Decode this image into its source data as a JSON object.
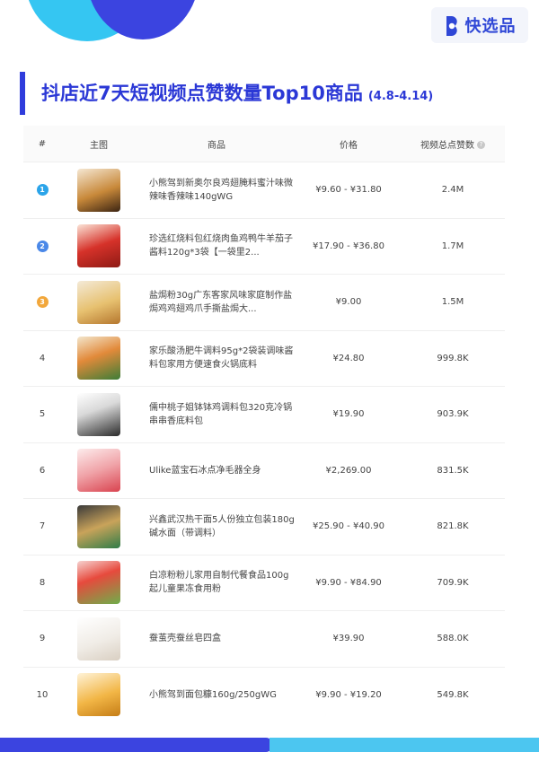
{
  "brand": {
    "name": "快选品",
    "logo_icon": "brand-b-icon"
  },
  "title": {
    "main": "抖店近7天短视频点赞数量Top10商品",
    "range": "(4.8-4.14)"
  },
  "colors": {
    "accent": "#2b38d6",
    "rank1": "#2ba4e9",
    "rank2": "#4a88e8",
    "rank3": "#f2a73b"
  },
  "table": {
    "headers": {
      "index": "#",
      "image": "主图",
      "name": "商品",
      "price": "价格",
      "likes": "视频总点赞数"
    },
    "help_icon": "question-circle-icon",
    "rows": [
      {
        "rank": "1",
        "name": "小熊驾到新奥尔良鸡翅腌料蜜汁味微辣味香辣味140gWG",
        "price": "¥9.60 - ¥31.80",
        "likes": "2.4M",
        "image_icon": "seasoning-jar-thumbnail"
      },
      {
        "rank": "2",
        "name": "珍选红烧料包红烧肉鱼鸡鸭牛羊茄子酱料120g*3袋【一袋里2...",
        "price": "¥17.90 - ¥36.80",
        "likes": "1.7M",
        "image_icon": "braise-sauce-thumbnail"
      },
      {
        "rank": "3",
        "name": "盐焗粉30g广东客家风味家庭制作盐焗鸡鸡翅鸡爪手撕盐焗大...",
        "price": "¥9.00",
        "likes": "1.5M",
        "image_icon": "salt-baked-powder-thumbnail"
      },
      {
        "rank": "4",
        "name": "家乐酸汤肥牛调料95g*2袋装调味酱料包家用方便速食火锅底料",
        "price": "¥24.80",
        "likes": "999.8K",
        "image_icon": "sour-soup-sauce-thumbnail"
      },
      {
        "rank": "5",
        "name": "儒中桃子姐钵钵鸡调料包320克冷锅串串香底料包",
        "price": "¥19.90",
        "likes": "903.9K",
        "image_icon": "bobo-chicken-sauce-thumbnail"
      },
      {
        "rank": "6",
        "name": "Ulike蓝宝石冰点净毛器全身",
        "price": "¥2,269.00",
        "likes": "831.5K",
        "image_icon": "hair-removal-device-thumbnail"
      },
      {
        "rank": "7",
        "name": "兴鑫武汉热干面5人份独立包装180g碱水面（带调料）",
        "price": "¥25.90 - ¥40.90",
        "likes": "821.8K",
        "image_icon": "hot-dry-noodles-thumbnail"
      },
      {
        "rank": "8",
        "name": "白凉粉粉儿家用自制代餐食品100g起儿童果冻食用粉",
        "price": "¥9.90 - ¥84.90",
        "likes": "709.9K",
        "image_icon": "jelly-powder-thumbnail"
      },
      {
        "rank": "9",
        "name": "蚕茧壳蚕丝皂四盒",
        "price": "¥39.90",
        "likes": "588.0K",
        "image_icon": "silk-soap-thumbnail"
      },
      {
        "rank": "10",
        "name": "小熊驾到面包糠160g/250gWG",
        "price": "¥9.90 - ¥19.20",
        "likes": "549.8K",
        "image_icon": "bread-crumbs-thumbnail"
      }
    ]
  }
}
